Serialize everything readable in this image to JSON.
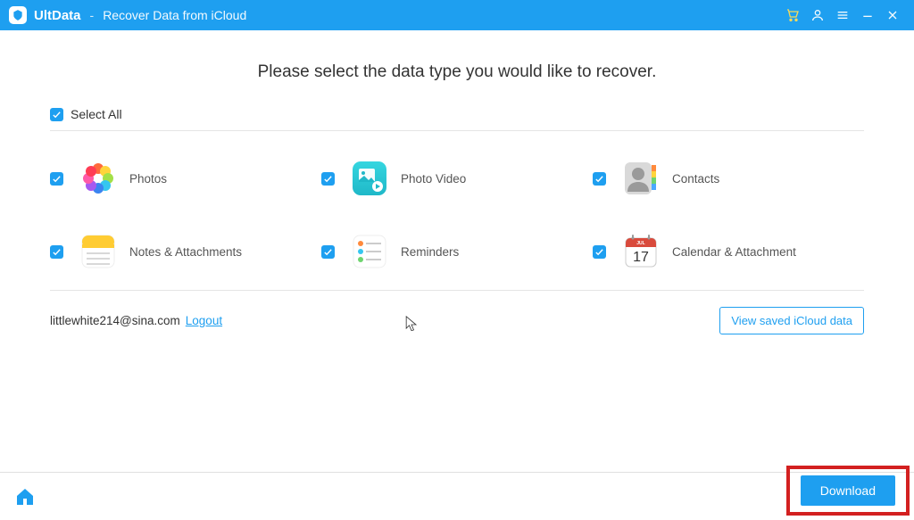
{
  "titlebar": {
    "app_name": "UltData",
    "separator": "-",
    "subtitle": "Recover Data from iCloud"
  },
  "main": {
    "heading": "Please select the data type you would like to recover.",
    "select_all_label": "Select All",
    "items": [
      {
        "label": "Photos"
      },
      {
        "label": "Photo Video"
      },
      {
        "label": "Contacts"
      },
      {
        "label": "Notes & Attachments"
      },
      {
        "label": "Reminders"
      },
      {
        "label": "Calendar & Attachment"
      }
    ],
    "account_email": "littlewhite214@sina.com",
    "logout_label": "Logout",
    "view_saved_label": "View saved iCloud data"
  },
  "bottombar": {
    "download_label": "Download"
  }
}
